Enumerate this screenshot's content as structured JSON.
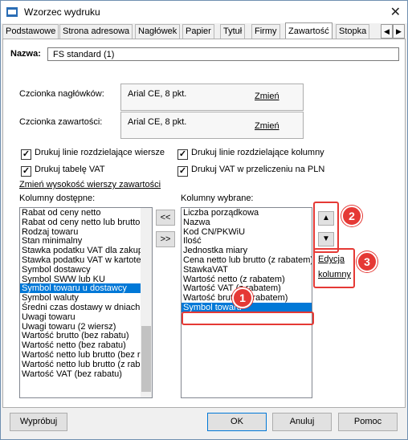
{
  "window": {
    "title": "Wzorzec wydruku"
  },
  "tabs": [
    "Podstawowe",
    "Strona adresowa",
    "Nagłówek",
    "Papier",
    "Tytuł",
    "Firmy",
    "Zawartość",
    "Stopka"
  ],
  "tab_scroll": {
    "left": "◀",
    "right": "▶"
  },
  "name": {
    "label": "Nazwa:",
    "value": "FS standard (1)"
  },
  "fonts": {
    "header_label": "Czcionka nagłówków:",
    "header_value": "Arial CE, 8 pkt.",
    "content_label": "Czcionka zawartości:",
    "content_value": "Arial CE, 8 pkt.",
    "change_link": "Zmień"
  },
  "checkboxes": [
    {
      "label": "Drukuj linie rozdzielające wiersze",
      "checked": "✓"
    },
    {
      "label": "Drukuj linie rozdzielające kolumny",
      "checked": "✓"
    },
    {
      "label": "Drukuj tabelę VAT",
      "checked": "✓"
    },
    {
      "label": "Drukuj VAT w przeliczeniu na PLN",
      "checked": "✓"
    }
  ],
  "row_height_link": "Zmień wysokość wierszy zawartości",
  "available": {
    "label": "Kolumny dostępne:",
    "items": [
      "Rabat od ceny netto",
      "Rabat od ceny netto lub brutto",
      "Rodzaj towaru",
      "Stan minimalny",
      "Stawka podatku VAT dla zakupu",
      "Stawka podatku VAT w kartotece",
      "Symbol dostawcy",
      "Symbol SWW lub KU",
      "Symbol towaru u dostawcy",
      "Symbol waluty",
      "Średni czas dostawy w dniach",
      "Uwagi towaru",
      "Uwagi towaru (2 wiersz)",
      "Wartość brutto (bez rabatu)",
      "Wartość netto (bez rabatu)",
      "Wartość netto lub brutto (bez rabatu)",
      "Wartość netto lub brutto (z rabatem)",
      "Wartość VAT (bez rabatu)"
    ]
  },
  "transfer": {
    "left": "<<",
    "right": ">>"
  },
  "selected": {
    "label": "Kolumny wybrane:",
    "items": [
      "Liczba porządkowa",
      "Nazwa",
      "Kod CN/PKWiU",
      "Ilość",
      "Jednostka miary",
      "Cena netto lub brutto (z rabatem)",
      "StawkaVAT",
      "Wartość netto (z rabatem)",
      "Wartość VAT (z rabatem)",
      "Wartość brutto (z rabatem)",
      "Symbol towaru"
    ]
  },
  "order": {
    "up": "▲",
    "down": "▼"
  },
  "edit_link": {
    "line1": "Edycja",
    "line2": "kolumny"
  },
  "badges": [
    "1",
    "2",
    "3"
  ],
  "buttons": {
    "preview": "Wypróbuj",
    "ok": "OK",
    "cancel": "Anuluj",
    "help": "Pomoc"
  },
  "colors": {
    "selection": "#0078d7",
    "annotation": "#e53935"
  }
}
